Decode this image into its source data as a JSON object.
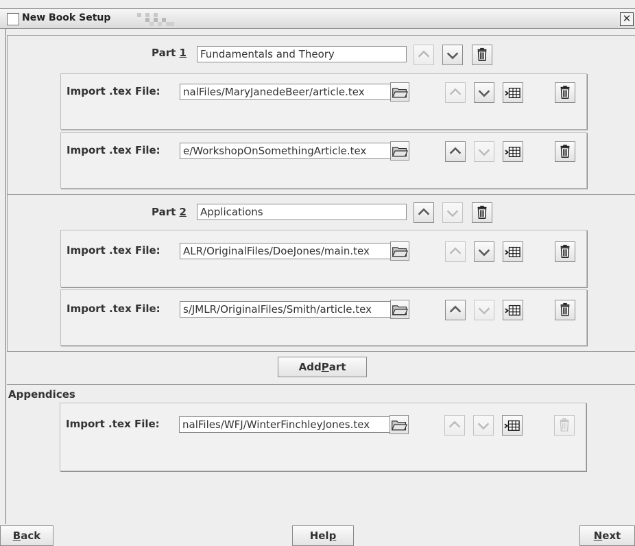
{
  "window": {
    "title": "New Book Setup",
    "close_glyph": "✕"
  },
  "parts": [
    {
      "label": "Part",
      "number": "1",
      "title": "Fundamentals and Theory",
      "files": [
        {
          "label": "Import .tex File:",
          "path": "nalFiles/MaryJanedeBeer/article.tex"
        },
        {
          "label": "Import .tex File:",
          "path": "e/WorkshopOnSomethingArticle.tex"
        }
      ]
    },
    {
      "label": "Part",
      "number": "2",
      "title": "Applications",
      "files": [
        {
          "label": "Import .tex File:",
          "path": "ALR/OriginalFiles/DoeJones/main.tex"
        },
        {
          "label": "Import .tex File:",
          "path": "s/JMLR/OriginalFiles/Smith/article.tex"
        }
      ]
    }
  ],
  "add_part": {
    "label": "Add ",
    "mnemonic": "P",
    "rest": "art"
  },
  "appendices": {
    "title": "Appendices",
    "files": [
      {
        "label": "Import .tex File:",
        "path": "nalFiles/WFJ/WinterFinchleyJones.tex"
      }
    ]
  },
  "footer": {
    "back": {
      "mnemonic": "B",
      "rest": "ack"
    },
    "help": {
      "label": "Hel",
      "mnemonic": "p"
    },
    "next": {
      "mnemonic": "N",
      "rest": "ext"
    }
  }
}
